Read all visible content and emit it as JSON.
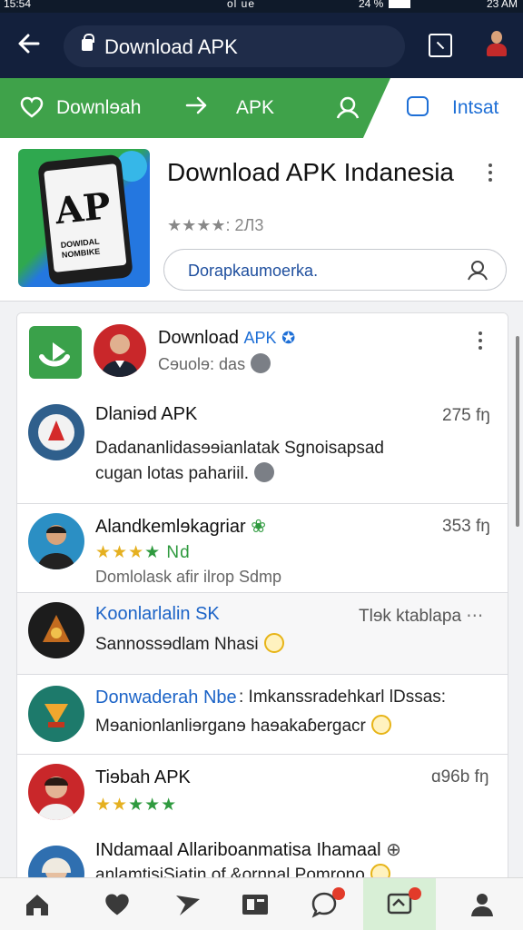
{
  "status_bar": {
    "left": "15:54",
    "center": "ol ue",
    "right": "24 %",
    "time": "23 AM"
  },
  "url_bar": {
    "url_text": "Download APK"
  },
  "nav_strip": {
    "label_1": "Downlɘah",
    "label_2": "APK",
    "label_3": "Intsat"
  },
  "featured": {
    "title": "Download APK Indanesia",
    "rating_text": "★★★★: 2Л3",
    "search_placeholder": "Dorapkaumoerka.",
    "icon_letters": "AP",
    "icon_subtext": "DOWIDAL\nNOMBIKE"
  },
  "list": [
    {
      "title_a": "Download ",
      "title_b": "APK",
      "subtitle": "Cɘuolɘ: das"
    },
    {
      "title": "Dlaniɘd APK",
      "meta": "275 fŋ",
      "line1": "Dadananlidasɘɘianlatak Sgnoisapsad",
      "line2": "cugan lotas pahariil."
    },
    {
      "title": "Alandkemlɘkagriar",
      "stars": "★★★",
      "stars_green": "★ Nd",
      "meta": "353 fŋ",
      "sub": "Domlolask afir ilrop Sdmp"
    },
    {
      "title": "Koonlarlalin SK",
      "meta": "Tlɘk ktablapa",
      "line1": "Sannossɘdlam Nhasi"
    },
    {
      "title": "Donwaderah Nbe",
      "meta": ": Imkanssradehkarl lDssas:",
      "line1": "Mɘanionlanliɘrganɘ haɘakaɓergacr"
    },
    {
      "title": "Tiɘbah APK",
      "stars": "★★",
      "stars_green": "★★★",
      "meta": "ɑ96b fŋ"
    },
    {
      "title": "INdamaal Allariboanmatisa Ihamaal",
      "line1": "aɲlamtisiSiatin of &ornnal Pomrono"
    }
  ],
  "icons": [
    "back-icon",
    "lock-icon",
    "tabs-icon",
    "profile-icon",
    "heart-icon",
    "arrow-right-icon",
    "search-user-icon",
    "chat-icon",
    "more-vert-icon",
    "search-icon",
    "home-icon",
    "heart-icon",
    "send-icon",
    "newspaper-icon",
    "chat-bubble-icon",
    "messages-icon",
    "person-icon"
  ]
}
